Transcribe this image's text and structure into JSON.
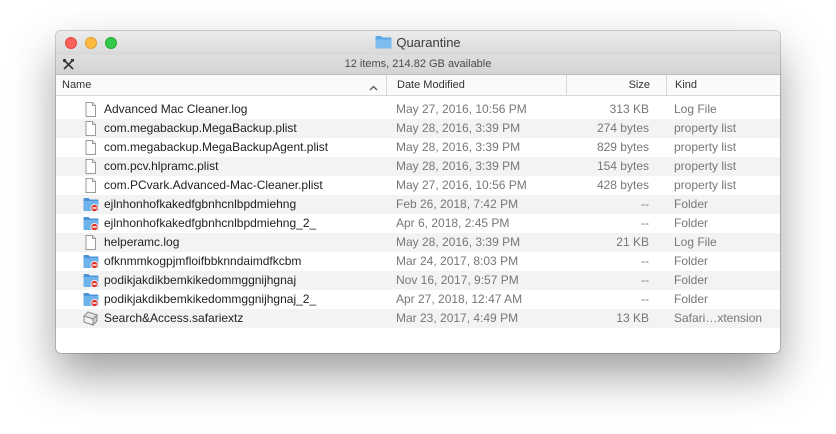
{
  "window": {
    "title": "Quarantine",
    "status": "12 items, 214.82 GB available",
    "colors": {
      "folder": "#5fa8e6",
      "badge": "#d9342b",
      "row_alt": "#f3f3f3"
    }
  },
  "columns": {
    "name": "Name",
    "date": "Date Modified",
    "size": "Size",
    "kind": "Kind"
  },
  "files": [
    {
      "icon": "document-icon",
      "name": "Advanced Mac Cleaner.log",
      "date": "May 27, 2016, 10:56 PM",
      "size": "313 KB",
      "kind": "Log File"
    },
    {
      "icon": "document-icon",
      "name": "com.megabackup.MegaBackup.plist",
      "date": "May 28, 2016, 3:39 PM",
      "size": "274 bytes",
      "kind": "property list"
    },
    {
      "icon": "document-icon",
      "name": "com.megabackup.MegaBackupAgent.plist",
      "date": "May 28, 2016, 3:39 PM",
      "size": "829 bytes",
      "kind": "property list"
    },
    {
      "icon": "document-icon",
      "name": "com.pcv.hlpramc.plist",
      "date": "May 28, 2016, 3:39 PM",
      "size": "154 bytes",
      "kind": "property list"
    },
    {
      "icon": "document-icon",
      "name": "com.PCvark.Advanced-Mac-Cleaner.plist",
      "date": "May 27, 2016, 10:56 PM",
      "size": "428 bytes",
      "kind": "property list"
    },
    {
      "icon": "restricted-folder-icon",
      "name": "ejlnhonhofkakedfgbnhcnlbpdmiehng",
      "date": "Feb 26, 2018, 7:42 PM",
      "size": "--",
      "kind": "Folder"
    },
    {
      "icon": "restricted-folder-icon",
      "name": "ejlnhonhofkakedfgbnhcnlbpdmiehng_2_",
      "date": "Apr 6, 2018, 2:45 PM",
      "size": "--",
      "kind": "Folder"
    },
    {
      "icon": "document-icon",
      "name": "helperamc.log",
      "date": "May 28, 2016, 3:39 PM",
      "size": "21 KB",
      "kind": "Log File"
    },
    {
      "icon": "restricted-folder-icon",
      "name": "ofknmmkogpjmfloifbbknndaimdfkcbm",
      "date": "Mar 24, 2017, 8:03 PM",
      "size": "--",
      "kind": "Folder"
    },
    {
      "icon": "restricted-folder-icon",
      "name": "podikjakdikbemkikedommggnijhgnaj",
      "date": "Nov 16, 2017, 9:57 PM",
      "size": "--",
      "kind": "Folder"
    },
    {
      "icon": "restricted-folder-icon",
      "name": "podikjakdikbemkikedommggnijhgnaj_2_",
      "date": "Apr 27, 2018, 12:47 AM",
      "size": "--",
      "kind": "Folder"
    },
    {
      "icon": "safari-extension-icon",
      "name": "Search&Access.safariextz",
      "date": "Mar 23, 2017, 4:49 PM",
      "size": "13 KB",
      "kind": "Safari…xtension"
    }
  ]
}
